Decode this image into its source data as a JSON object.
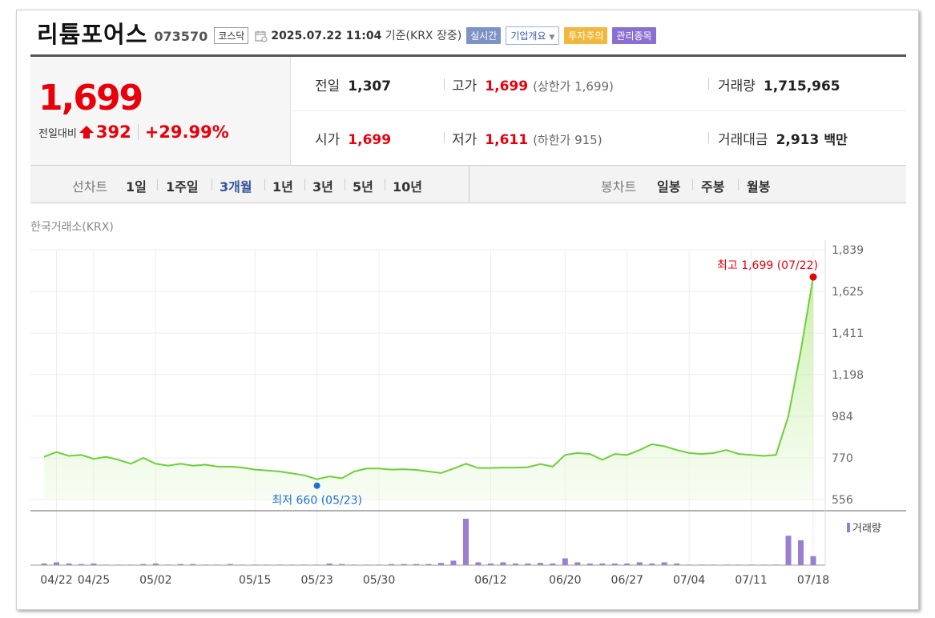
{
  "header": {
    "stock_name": "리튬포어스",
    "stock_code": "073570",
    "market": "코스닥",
    "datetime": "2025.07.22 11:04",
    "basis": "기준(KRX 장중)",
    "tags": [
      "실시간",
      "기업개요",
      "투자주의",
      "관리종목"
    ],
    "colors": {
      "up": "#e8000b",
      "low_marker": "#1b6fd6",
      "line": "#6dcf3b",
      "volume": "#9a7fd0"
    }
  },
  "quote": {
    "price": "1,699",
    "diff_label": "전일대비",
    "diff": "392",
    "rate": "+29.99%"
  },
  "info": {
    "prev_label": "전일",
    "prev": "1,307",
    "high_label": "고가",
    "high": "1,699",
    "upper_limit": "(상한가 1,699)",
    "volume_label": "거래량",
    "volume": "1,715,965",
    "open_label": "시가",
    "open": "1,699",
    "low_label": "저가",
    "low": "1,611",
    "lower_limit": "(하한가 915)",
    "amount_label": "거래대금",
    "amount": "2,913",
    "amount_unit": "백만"
  },
  "period": {
    "line_label": "선차트",
    "line_items": [
      "1일",
      "1주일",
      "3개월",
      "1년",
      "3년",
      "5년",
      "10년"
    ],
    "active": "3개월",
    "candle_label": "봉차트",
    "candle_items": [
      "일봉",
      "주봉",
      "월봉"
    ]
  },
  "exchange": "한국거래소(KRX)",
  "chart_data": {
    "type": "area",
    "title": "",
    "xlabel": "",
    "ylabel": "",
    "ylim": [
      556,
      1839
    ],
    "y_ticks": [
      "1,839",
      "1,625",
      "1,411",
      "1,198",
      "984",
      "770",
      "556"
    ],
    "y_tick_values": [
      1839,
      1625,
      1411,
      1198,
      984,
      770,
      556
    ],
    "x_tick_labels": [
      "04/22",
      "04/25",
      "05/02",
      "05/15",
      "05/23",
      "05/30",
      "06/12",
      "06/20",
      "06/27",
      "07/04",
      "07/11",
      "07/18"
    ],
    "x_tick_index": [
      1,
      4,
      9,
      17,
      22,
      27,
      36,
      42,
      47,
      52,
      57,
      62
    ],
    "grid": true,
    "high_annotation": "최고 1,699 (07/22)",
    "low_annotation": "최저 660 (05/23)",
    "high_index": 65,
    "low_index": 22,
    "series": [
      {
        "values": [
          775,
          800,
          780,
          785,
          765,
          775,
          760,
          740,
          770,
          740,
          730,
          740,
          730,
          735,
          725,
          725,
          720,
          710,
          705,
          700,
          690,
          680,
          660,
          675,
          665,
          700,
          715,
          715,
          710,
          712,
          708,
          700,
          692,
          715,
          740,
          718,
          718,
          720,
          720,
          722,
          738,
          725,
          785,
          795,
          790,
          760,
          790,
          785,
          810,
          840,
          830,
          810,
          795,
          790,
          795,
          810,
          790,
          785,
          780,
          785,
          985,
          1320,
          1699
        ]
      }
    ],
    "volume_legend": "거래량",
    "volume": [
      3,
      5,
      3,
      2,
      3,
      1,
      1,
      1,
      2,
      3,
      1,
      2,
      2,
      1,
      1,
      2,
      1,
      1,
      1,
      1,
      1,
      1,
      1,
      3,
      2,
      1,
      1,
      1,
      2,
      2,
      2,
      2,
      4,
      8,
      82,
      5,
      3,
      5,
      3,
      3,
      4,
      3,
      12,
      5,
      3,
      3,
      3,
      3,
      5,
      3,
      5,
      3,
      1,
      1,
      1,
      1,
      1,
      1,
      1,
      1,
      52,
      44,
      16
    ]
  }
}
